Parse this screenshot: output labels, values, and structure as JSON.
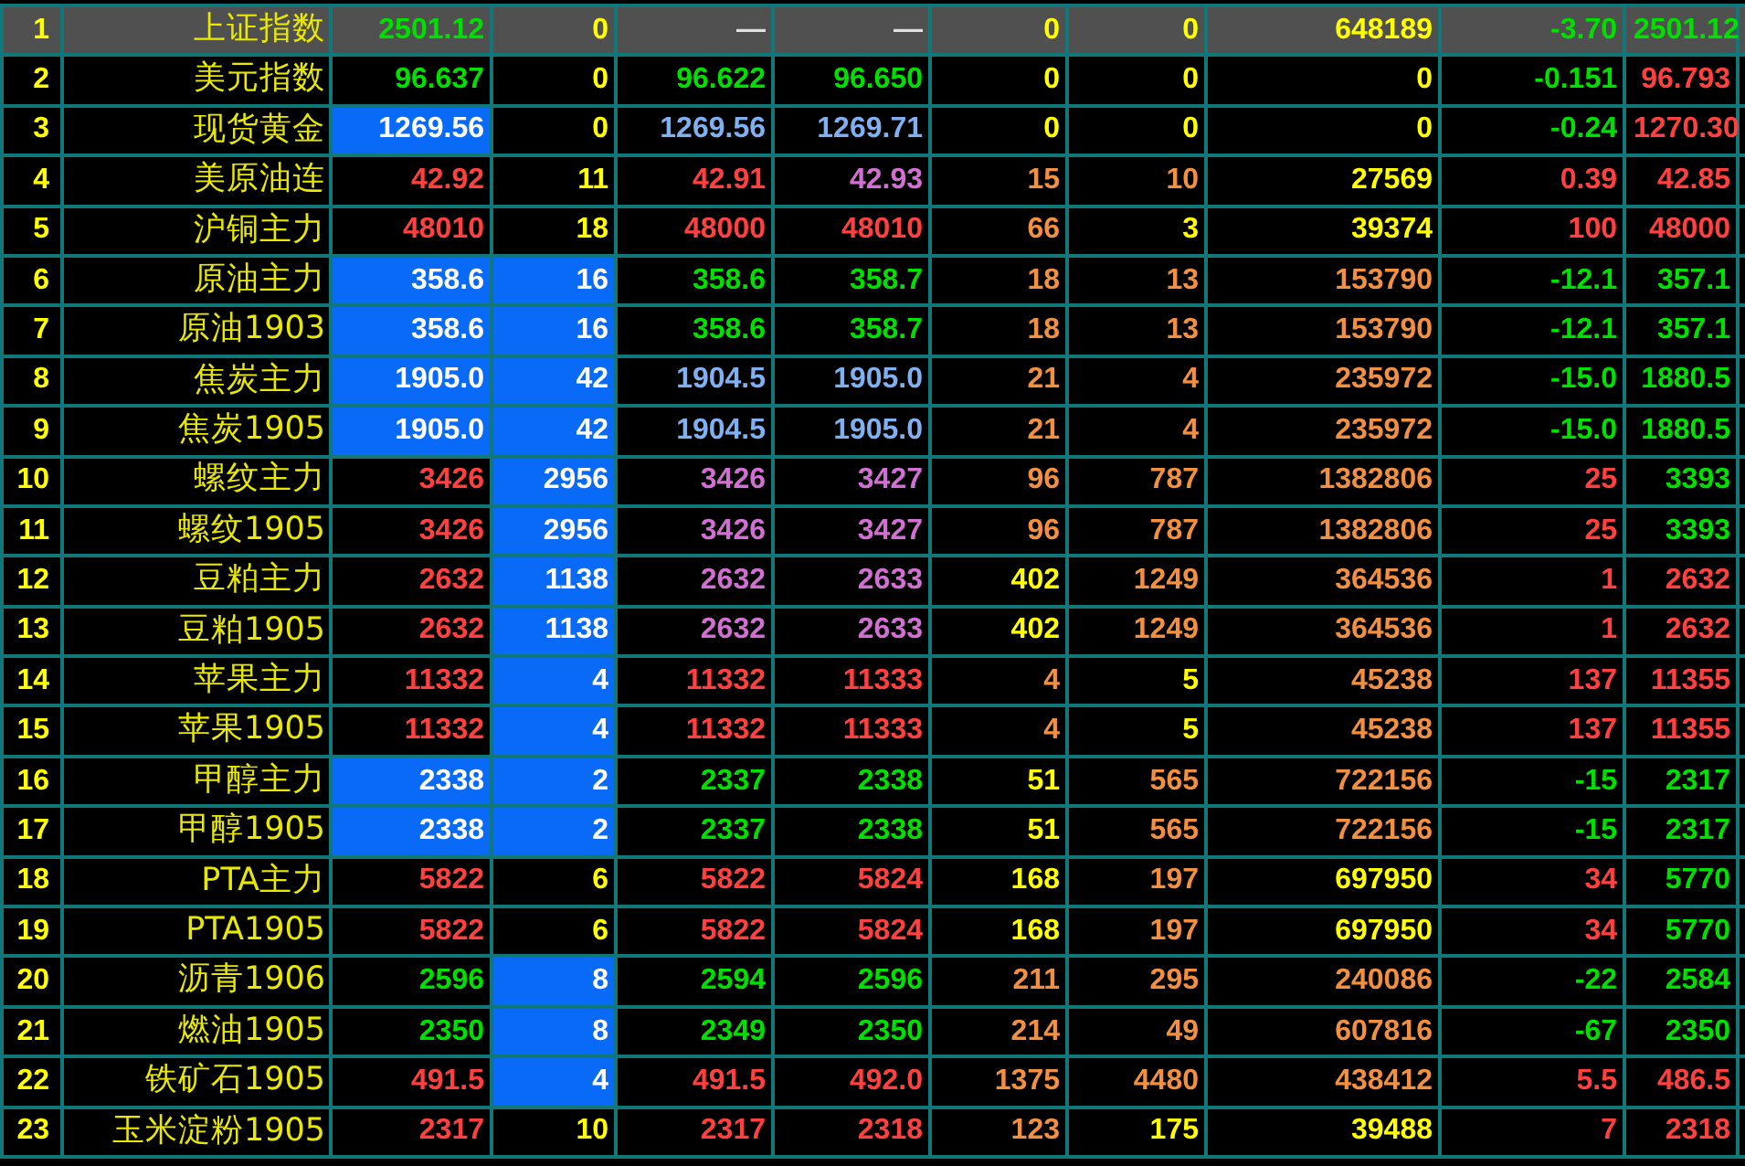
{
  "rows": [
    {
      "index": "1",
      "name": "上证指数",
      "selected": true,
      "cells": [
        {
          "text": "2501.12",
          "color": "#00e000",
          "flash": false
        },
        {
          "text": "0",
          "color": "#ffff00",
          "flash": false
        },
        {
          "text": "—",
          "color": "#e0e0e0",
          "flash": false
        },
        {
          "text": "—",
          "color": "#e0e0e0",
          "flash": false
        },
        {
          "text": "0",
          "color": "#ffff00",
          "flash": false
        },
        {
          "text": "0",
          "color": "#ffff00",
          "flash": false
        },
        {
          "text": "648189",
          "color": "#ffff00",
          "flash": false
        },
        {
          "text": "-3.70",
          "color": "#00e000",
          "flash": false
        },
        {
          "text": "2501.12",
          "color": "#00e000",
          "flash": false
        }
      ]
    },
    {
      "index": "2",
      "name": "美元指数",
      "selected": false,
      "cells": [
        {
          "text": "96.637",
          "color": "#00e000",
          "flash": false
        },
        {
          "text": "0",
          "color": "#ffff00",
          "flash": false
        },
        {
          "text": "96.622",
          "color": "#00e000",
          "flash": false
        },
        {
          "text": "96.650",
          "color": "#00e000",
          "flash": false
        },
        {
          "text": "0",
          "color": "#ffff00",
          "flash": false
        },
        {
          "text": "0",
          "color": "#ffff00",
          "flash": false
        },
        {
          "text": "0",
          "color": "#ffff00",
          "flash": false
        },
        {
          "text": "-0.151",
          "color": "#00e000",
          "flash": false
        },
        {
          "text": "96.793",
          "color": "#ff4040",
          "flash": false
        }
      ]
    },
    {
      "index": "3",
      "name": "现货黄金",
      "selected": false,
      "cells": [
        {
          "text": "1269.56",
          "color": "#ffffff",
          "flash": true
        },
        {
          "text": "0",
          "color": "#ffff00",
          "flash": false
        },
        {
          "text": "1269.56",
          "color": "#80b0f0",
          "flash": false
        },
        {
          "text": "1269.71",
          "color": "#80b0f0",
          "flash": false
        },
        {
          "text": "0",
          "color": "#ffff00",
          "flash": false
        },
        {
          "text": "0",
          "color": "#ffff00",
          "flash": false
        },
        {
          "text": "0",
          "color": "#ffff00",
          "flash": false
        },
        {
          "text": "-0.24",
          "color": "#00e000",
          "flash": false
        },
        {
          "text": "1270.30",
          "color": "#ff4040",
          "flash": false
        }
      ]
    },
    {
      "index": "4",
      "name": "美原油连",
      "selected": false,
      "cells": [
        {
          "text": "42.92",
          "color": "#ff4040",
          "flash": false
        },
        {
          "text": "11",
          "color": "#ffff00",
          "flash": false
        },
        {
          "text": "42.91",
          "color": "#ff4040",
          "flash": false
        },
        {
          "text": "42.93",
          "color": "#d070d0",
          "flash": false
        },
        {
          "text": "15",
          "color": "#f09040",
          "flash": false
        },
        {
          "text": "10",
          "color": "#f09040",
          "flash": false
        },
        {
          "text": "27569",
          "color": "#ffff00",
          "flash": false
        },
        {
          "text": "0.39",
          "color": "#ff4040",
          "flash": false
        },
        {
          "text": "42.85",
          "color": "#ff4040",
          "flash": false
        }
      ]
    },
    {
      "index": "5",
      "name": "沪铜主力",
      "selected": false,
      "cells": [
        {
          "text": "48010",
          "color": "#ff4040",
          "flash": false
        },
        {
          "text": "18",
          "color": "#ffff00",
          "flash": false
        },
        {
          "text": "48000",
          "color": "#ff4040",
          "flash": false
        },
        {
          "text": "48010",
          "color": "#ff4040",
          "flash": false
        },
        {
          "text": "66",
          "color": "#f09040",
          "flash": false
        },
        {
          "text": "3",
          "color": "#ffff00",
          "flash": false
        },
        {
          "text": "39374",
          "color": "#ffff00",
          "flash": false
        },
        {
          "text": "100",
          "color": "#ff4040",
          "flash": false
        },
        {
          "text": "48000",
          "color": "#ff4040",
          "flash": false
        }
      ]
    },
    {
      "index": "6",
      "name": "原油主力",
      "selected": false,
      "cells": [
        {
          "text": "358.6",
          "color": "#ffffff",
          "flash": true
        },
        {
          "text": "16",
          "color": "#ffffff",
          "flash": true
        },
        {
          "text": "358.6",
          "color": "#00e000",
          "flash": false
        },
        {
          "text": "358.7",
          "color": "#00e000",
          "flash": false
        },
        {
          "text": "18",
          "color": "#f09040",
          "flash": false
        },
        {
          "text": "13",
          "color": "#f09040",
          "flash": false
        },
        {
          "text": "153790",
          "color": "#f09040",
          "flash": false
        },
        {
          "text": "-12.1",
          "color": "#00e000",
          "flash": false
        },
        {
          "text": "357.1",
          "color": "#00e000",
          "flash": false
        }
      ]
    },
    {
      "index": "7",
      "name": "原油1903",
      "selected": false,
      "cells": [
        {
          "text": "358.6",
          "color": "#ffffff",
          "flash": true
        },
        {
          "text": "16",
          "color": "#ffffff",
          "flash": true
        },
        {
          "text": "358.6",
          "color": "#00e000",
          "flash": false
        },
        {
          "text": "358.7",
          "color": "#00e000",
          "flash": false
        },
        {
          "text": "18",
          "color": "#f09040",
          "flash": false
        },
        {
          "text": "13",
          "color": "#f09040",
          "flash": false
        },
        {
          "text": "153790",
          "color": "#f09040",
          "flash": false
        },
        {
          "text": "-12.1",
          "color": "#00e000",
          "flash": false
        },
        {
          "text": "357.1",
          "color": "#00e000",
          "flash": false
        }
      ]
    },
    {
      "index": "8",
      "name": "焦炭主力",
      "selected": false,
      "cells": [
        {
          "text": "1905.0",
          "color": "#ffffff",
          "flash": true
        },
        {
          "text": "42",
          "color": "#ffffff",
          "flash": true
        },
        {
          "text": "1904.5",
          "color": "#80b0f0",
          "flash": false
        },
        {
          "text": "1905.0",
          "color": "#80b0f0",
          "flash": false
        },
        {
          "text": "21",
          "color": "#f09040",
          "flash": false
        },
        {
          "text": "4",
          "color": "#f09040",
          "flash": false
        },
        {
          "text": "235972",
          "color": "#f09040",
          "flash": false
        },
        {
          "text": "-15.0",
          "color": "#00e000",
          "flash": false
        },
        {
          "text": "1880.5",
          "color": "#00e000",
          "flash": false
        }
      ]
    },
    {
      "index": "9",
      "name": "焦炭1905",
      "selected": false,
      "cells": [
        {
          "text": "1905.0",
          "color": "#ffffff",
          "flash": true
        },
        {
          "text": "42",
          "color": "#ffffff",
          "flash": true
        },
        {
          "text": "1904.5",
          "color": "#80b0f0",
          "flash": false
        },
        {
          "text": "1905.0",
          "color": "#80b0f0",
          "flash": false
        },
        {
          "text": "21",
          "color": "#f09040",
          "flash": false
        },
        {
          "text": "4",
          "color": "#f09040",
          "flash": false
        },
        {
          "text": "235972",
          "color": "#f09040",
          "flash": false
        },
        {
          "text": "-15.0",
          "color": "#00e000",
          "flash": false
        },
        {
          "text": "1880.5",
          "color": "#00e000",
          "flash": false
        }
      ]
    },
    {
      "index": "10",
      "name": "螺纹主力",
      "selected": false,
      "cells": [
        {
          "text": "3426",
          "color": "#ff4040",
          "flash": false
        },
        {
          "text": "2956",
          "color": "#ffffff",
          "flash": true
        },
        {
          "text": "3426",
          "color": "#d070d0",
          "flash": false
        },
        {
          "text": "3427",
          "color": "#d070d0",
          "flash": false
        },
        {
          "text": "96",
          "color": "#f09040",
          "flash": false
        },
        {
          "text": "787",
          "color": "#f09040",
          "flash": false
        },
        {
          "text": "1382806",
          "color": "#f09040",
          "flash": false
        },
        {
          "text": "25",
          "color": "#ff4040",
          "flash": false
        },
        {
          "text": "3393",
          "color": "#00e000",
          "flash": false
        }
      ]
    },
    {
      "index": "11",
      "name": "螺纹1905",
      "selected": false,
      "cells": [
        {
          "text": "3426",
          "color": "#ff4040",
          "flash": false
        },
        {
          "text": "2956",
          "color": "#ffffff",
          "flash": true
        },
        {
          "text": "3426",
          "color": "#d070d0",
          "flash": false
        },
        {
          "text": "3427",
          "color": "#d070d0",
          "flash": false
        },
        {
          "text": "96",
          "color": "#f09040",
          "flash": false
        },
        {
          "text": "787",
          "color": "#f09040",
          "flash": false
        },
        {
          "text": "1382806",
          "color": "#f09040",
          "flash": false
        },
        {
          "text": "25",
          "color": "#ff4040",
          "flash": false
        },
        {
          "text": "3393",
          "color": "#00e000",
          "flash": false
        }
      ]
    },
    {
      "index": "12",
      "name": "豆粕主力",
      "selected": false,
      "cells": [
        {
          "text": "2632",
          "color": "#ff4040",
          "flash": false
        },
        {
          "text": "1138",
          "color": "#ffffff",
          "flash": true
        },
        {
          "text": "2632",
          "color": "#d070d0",
          "flash": false
        },
        {
          "text": "2633",
          "color": "#d070d0",
          "flash": false
        },
        {
          "text": "402",
          "color": "#ffff00",
          "flash": false
        },
        {
          "text": "1249",
          "color": "#f09040",
          "flash": false
        },
        {
          "text": "364536",
          "color": "#f09040",
          "flash": false
        },
        {
          "text": "1",
          "color": "#ff4040",
          "flash": false
        },
        {
          "text": "2632",
          "color": "#ff4040",
          "flash": false
        }
      ]
    },
    {
      "index": "13",
      "name": "豆粕1905",
      "selected": false,
      "cells": [
        {
          "text": "2632",
          "color": "#ff4040",
          "flash": false
        },
        {
          "text": "1138",
          "color": "#ffffff",
          "flash": true
        },
        {
          "text": "2632",
          "color": "#d070d0",
          "flash": false
        },
        {
          "text": "2633",
          "color": "#d070d0",
          "flash": false
        },
        {
          "text": "402",
          "color": "#ffff00",
          "flash": false
        },
        {
          "text": "1249",
          "color": "#f09040",
          "flash": false
        },
        {
          "text": "364536",
          "color": "#f09040",
          "flash": false
        },
        {
          "text": "1",
          "color": "#ff4040",
          "flash": false
        },
        {
          "text": "2632",
          "color": "#ff4040",
          "flash": false
        }
      ]
    },
    {
      "index": "14",
      "name": "苹果主力",
      "selected": false,
      "cells": [
        {
          "text": "11332",
          "color": "#ff4040",
          "flash": false
        },
        {
          "text": "4",
          "color": "#ffffff",
          "flash": true
        },
        {
          "text": "11332",
          "color": "#ff4040",
          "flash": false
        },
        {
          "text": "11333",
          "color": "#ff4040",
          "flash": false
        },
        {
          "text": "4",
          "color": "#f09040",
          "flash": false
        },
        {
          "text": "5",
          "color": "#ffff00",
          "flash": false
        },
        {
          "text": "45238",
          "color": "#f09040",
          "flash": false
        },
        {
          "text": "137",
          "color": "#ff4040",
          "flash": false
        },
        {
          "text": "11355",
          "color": "#ff4040",
          "flash": false
        }
      ]
    },
    {
      "index": "15",
      "name": "苹果1905",
      "selected": false,
      "cells": [
        {
          "text": "11332",
          "color": "#ff4040",
          "flash": false
        },
        {
          "text": "4",
          "color": "#ffffff",
          "flash": true
        },
        {
          "text": "11332",
          "color": "#ff4040",
          "flash": false
        },
        {
          "text": "11333",
          "color": "#ff4040",
          "flash": false
        },
        {
          "text": "4",
          "color": "#f09040",
          "flash": false
        },
        {
          "text": "5",
          "color": "#ffff00",
          "flash": false
        },
        {
          "text": "45238",
          "color": "#f09040",
          "flash": false
        },
        {
          "text": "137",
          "color": "#ff4040",
          "flash": false
        },
        {
          "text": "11355",
          "color": "#ff4040",
          "flash": false
        }
      ]
    },
    {
      "index": "16",
      "name": "甲醇主力",
      "selected": false,
      "cells": [
        {
          "text": "2338",
          "color": "#ffffff",
          "flash": true
        },
        {
          "text": "2",
          "color": "#ffffff",
          "flash": true
        },
        {
          "text": "2337",
          "color": "#00e000",
          "flash": false
        },
        {
          "text": "2338",
          "color": "#00e000",
          "flash": false
        },
        {
          "text": "51",
          "color": "#ffff00",
          "flash": false
        },
        {
          "text": "565",
          "color": "#f09040",
          "flash": false
        },
        {
          "text": "722156",
          "color": "#f09040",
          "flash": false
        },
        {
          "text": "-15",
          "color": "#00e000",
          "flash": false
        },
        {
          "text": "2317",
          "color": "#00e000",
          "flash": false
        }
      ]
    },
    {
      "index": "17",
      "name": "甲醇1905",
      "selected": false,
      "cells": [
        {
          "text": "2338",
          "color": "#ffffff",
          "flash": true
        },
        {
          "text": "2",
          "color": "#ffffff",
          "flash": true
        },
        {
          "text": "2337",
          "color": "#00e000",
          "flash": false
        },
        {
          "text": "2338",
          "color": "#00e000",
          "flash": false
        },
        {
          "text": "51",
          "color": "#ffff00",
          "flash": false
        },
        {
          "text": "565",
          "color": "#f09040",
          "flash": false
        },
        {
          "text": "722156",
          "color": "#f09040",
          "flash": false
        },
        {
          "text": "-15",
          "color": "#00e000",
          "flash": false
        },
        {
          "text": "2317",
          "color": "#00e000",
          "flash": false
        }
      ]
    },
    {
      "index": "18",
      "name": "PTA主力",
      "selected": false,
      "cells": [
        {
          "text": "5822",
          "color": "#ff4040",
          "flash": false
        },
        {
          "text": "6",
          "color": "#ffff00",
          "flash": false
        },
        {
          "text": "5822",
          "color": "#ff4040",
          "flash": false
        },
        {
          "text": "5824",
          "color": "#ff4040",
          "flash": false
        },
        {
          "text": "168",
          "color": "#ffff00",
          "flash": false
        },
        {
          "text": "197",
          "color": "#f09040",
          "flash": false
        },
        {
          "text": "697950",
          "color": "#ffff00",
          "flash": false
        },
        {
          "text": "34",
          "color": "#ff4040",
          "flash": false
        },
        {
          "text": "5770",
          "color": "#00e000",
          "flash": false
        }
      ]
    },
    {
      "index": "19",
      "name": "PTA1905",
      "selected": false,
      "cells": [
        {
          "text": "5822",
          "color": "#ff4040",
          "flash": false
        },
        {
          "text": "6",
          "color": "#ffff00",
          "flash": false
        },
        {
          "text": "5822",
          "color": "#ff4040",
          "flash": false
        },
        {
          "text": "5824",
          "color": "#ff4040",
          "flash": false
        },
        {
          "text": "168",
          "color": "#ffff00",
          "flash": false
        },
        {
          "text": "197",
          "color": "#f09040",
          "flash": false
        },
        {
          "text": "697950",
          "color": "#ffff00",
          "flash": false
        },
        {
          "text": "34",
          "color": "#ff4040",
          "flash": false
        },
        {
          "text": "5770",
          "color": "#00e000",
          "flash": false
        }
      ]
    },
    {
      "index": "20",
      "name": "沥青1906",
      "selected": false,
      "cells": [
        {
          "text": "2596",
          "color": "#00e000",
          "flash": false
        },
        {
          "text": "8",
          "color": "#ffffff",
          "flash": true
        },
        {
          "text": "2594",
          "color": "#00e000",
          "flash": false
        },
        {
          "text": "2596",
          "color": "#00e000",
          "flash": false
        },
        {
          "text": "211",
          "color": "#f09040",
          "flash": false
        },
        {
          "text": "295",
          "color": "#f09040",
          "flash": false
        },
        {
          "text": "240086",
          "color": "#f09040",
          "flash": false
        },
        {
          "text": "-22",
          "color": "#00e000",
          "flash": false
        },
        {
          "text": "2584",
          "color": "#00e000",
          "flash": false
        }
      ]
    },
    {
      "index": "21",
      "name": "燃油1905",
      "selected": false,
      "cells": [
        {
          "text": "2350",
          "color": "#00e000",
          "flash": false
        },
        {
          "text": "8",
          "color": "#ffffff",
          "flash": true
        },
        {
          "text": "2349",
          "color": "#00e000",
          "flash": false
        },
        {
          "text": "2350",
          "color": "#00e000",
          "flash": false
        },
        {
          "text": "214",
          "color": "#f09040",
          "flash": false
        },
        {
          "text": "49",
          "color": "#f09040",
          "flash": false
        },
        {
          "text": "607816",
          "color": "#f09040",
          "flash": false
        },
        {
          "text": "-67",
          "color": "#00e000",
          "flash": false
        },
        {
          "text": "2350",
          "color": "#00e000",
          "flash": false
        }
      ]
    },
    {
      "index": "22",
      "name": "铁矿石1905",
      "selected": false,
      "cells": [
        {
          "text": "491.5",
          "color": "#ff4040",
          "flash": false
        },
        {
          "text": "4",
          "color": "#ffffff",
          "flash": true
        },
        {
          "text": "491.5",
          "color": "#ff4040",
          "flash": false
        },
        {
          "text": "492.0",
          "color": "#ff4040",
          "flash": false
        },
        {
          "text": "1375",
          "color": "#f09040",
          "flash": false
        },
        {
          "text": "4480",
          "color": "#f09040",
          "flash": false
        },
        {
          "text": "438412",
          "color": "#f09040",
          "flash": false
        },
        {
          "text": "5.5",
          "color": "#ff4040",
          "flash": false
        },
        {
          "text": "486.5",
          "color": "#ff4040",
          "flash": false
        }
      ]
    },
    {
      "index": "23",
      "name": "玉米淀粉1905",
      "selected": false,
      "cells": [
        {
          "text": "2317",
          "color": "#ff4040",
          "flash": false
        },
        {
          "text": "10",
          "color": "#ffff00",
          "flash": false
        },
        {
          "text": "2317",
          "color": "#ff4040",
          "flash": false
        },
        {
          "text": "2318",
          "color": "#ff4040",
          "flash": false
        },
        {
          "text": "123",
          "color": "#f09040",
          "flash": false
        },
        {
          "text": "175",
          "color": "#ffff00",
          "flash": false
        },
        {
          "text": "39488",
          "color": "#ffff00",
          "flash": false
        },
        {
          "text": "7",
          "color": "#ff4040",
          "flash": false
        },
        {
          "text": "2318",
          "color": "#ff4040",
          "flash": false
        }
      ]
    }
  ]
}
